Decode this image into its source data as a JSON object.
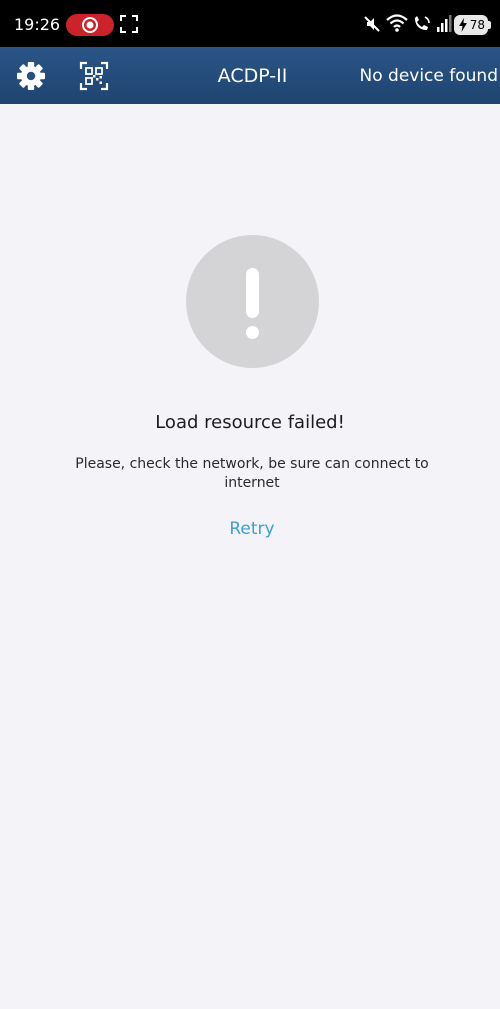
{
  "status_bar": {
    "time": "19:26",
    "battery_level": "78",
    "icons": [
      "screen-record-icon",
      "screenshot-frame-icon",
      "mute-icon",
      "wifi-icon",
      "volte-call-icon",
      "signal-icon",
      "battery-icon"
    ]
  },
  "app_bar": {
    "title": "ACDP-II",
    "device_status": "No device found",
    "icons": [
      "gear-icon",
      "qr-scan-icon"
    ]
  },
  "error": {
    "icon": "exclamation-icon",
    "title": "Load resource failed!",
    "message": "Please, check the network, be sure can connect to internet",
    "retry_label": "Retry"
  },
  "colors": {
    "app_bar": "#2a5586",
    "background": "#f4f4f8",
    "error_circle": "#d4d4d6",
    "link": "#3a9fd6",
    "record_pill": "#cc2229"
  }
}
